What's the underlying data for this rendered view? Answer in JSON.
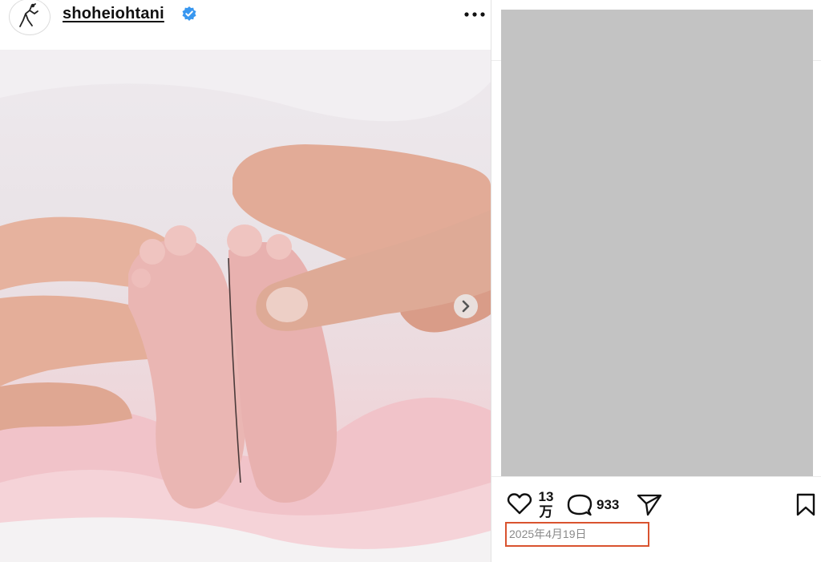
{
  "post": {
    "username": "shoheiohtani",
    "verified": true,
    "likes_label": "13万",
    "comments_count": "933",
    "date": "2025年4月19日"
  },
  "icons": {
    "avatar": "baseball-player-logo",
    "verified": "verified-badge-icon",
    "more": "more-options-icon",
    "next": "chevron-right-icon",
    "like": "heart-icon",
    "comment": "comment-bubble-icon",
    "share": "paper-plane-icon",
    "bookmark": "bookmark-icon"
  },
  "colors": {
    "verified_blue": "#3897f0",
    "highlight_border": "#d9532f",
    "caption_redacted": "#c3c3c3"
  }
}
